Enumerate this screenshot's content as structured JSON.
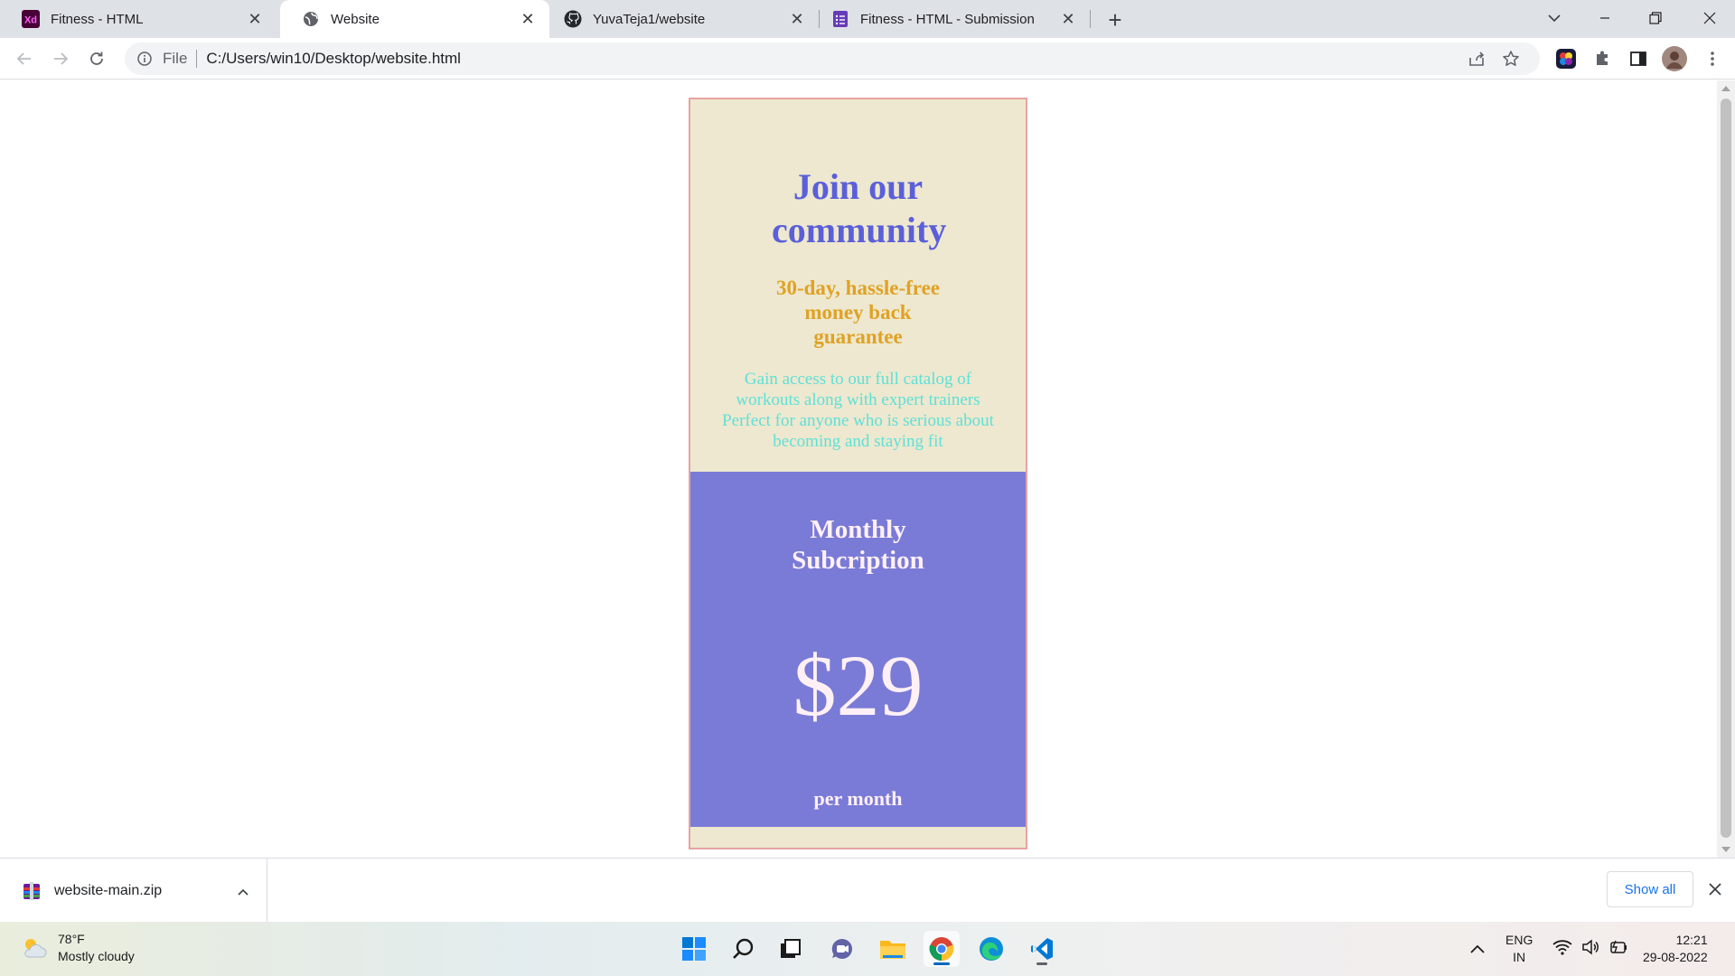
{
  "browser": {
    "tabs": [
      {
        "title": "Fitness - HTML",
        "icon": "adobe-xd-icon",
        "active": false
      },
      {
        "title": "Website",
        "icon": "globe-icon",
        "active": true
      },
      {
        "title": "YuvaTeja1/website",
        "icon": "github-icon",
        "active": false
      },
      {
        "title": "Fitness - HTML - Submission",
        "icon": "forms-icon",
        "active": false
      }
    ],
    "address": {
      "scheme": "File",
      "url": "C:/Users/win10/Desktop/website.html"
    }
  },
  "page": {
    "heading": "Join our community",
    "guarantee": "30-day, hassle-free money back guarantee",
    "description": "Gain access to our full catalog of workouts along with expert trainers Perfect for anyone who is serious about becoming and staying fit",
    "plan_title": "Monthly Subcription",
    "price": "$29",
    "period": "per month",
    "colors": {
      "card_bg": "#ede8cf",
      "card_border": "#e7a3a3",
      "heading": "#5b5fd9",
      "guarantee": "#e0a224",
      "description": "#5fe0d7",
      "plan_bg": "#7a7bd7",
      "plan_text": "#fff0f5"
    }
  },
  "downloads": {
    "file": "website-main.zip",
    "show_all": "Show all"
  },
  "taskbar": {
    "weather": {
      "temp": "78°F",
      "condition": "Mostly cloudy"
    },
    "apps": [
      "windows-start",
      "search",
      "task-view",
      "teams-chat",
      "file-explorer",
      "chrome",
      "edge",
      "vscode"
    ],
    "language": {
      "lang": "ENG",
      "region": "IN"
    },
    "time": "12:21",
    "date": "29-08-2022"
  }
}
